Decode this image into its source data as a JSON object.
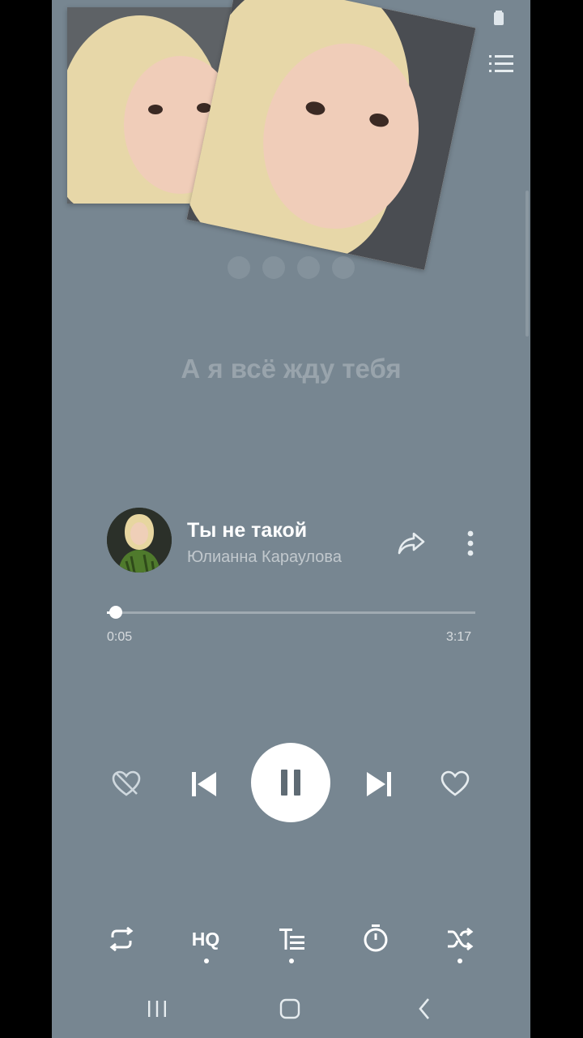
{
  "lyrics": {
    "current_line": "А я всё жду тебя"
  },
  "track": {
    "title": "Ты не такой",
    "artist": "Юлианна Караулова",
    "elapsed": "0:05",
    "duration": "3:17",
    "progress_fraction": 0.025
  },
  "toolbar": {
    "hq_label": "HQ"
  },
  "colors": {
    "background": "#778691",
    "accent": "#ffffff"
  }
}
